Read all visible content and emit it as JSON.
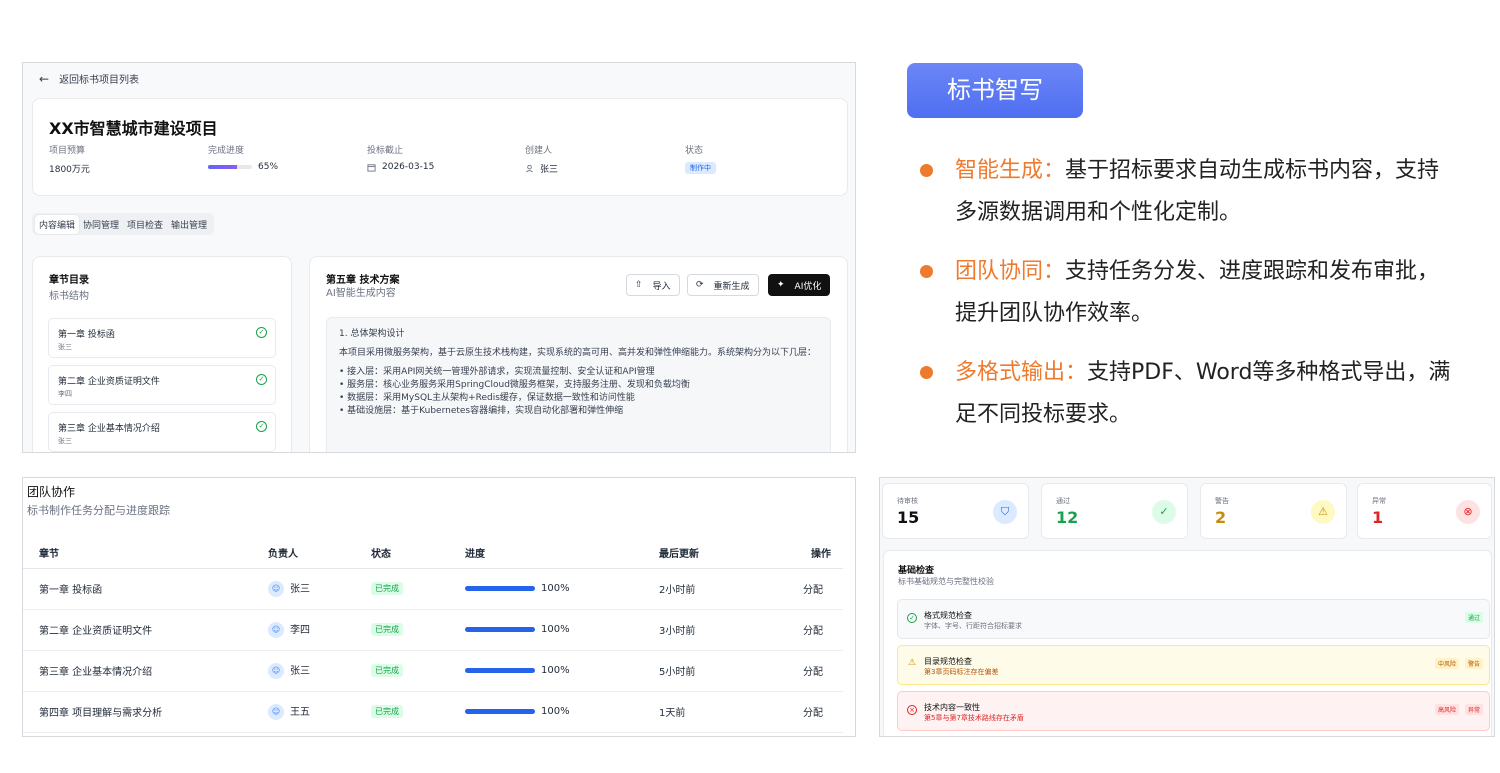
{
  "project": {
    "back_label": "返回标书项目列表",
    "title": "XX市智慧城市建设项目",
    "budget_label": "项目预算",
    "budget_value": "1800万元",
    "progress_label": "完成进度",
    "progress_value": "65%",
    "progress_fraction": 0.65,
    "deadline_label": "投标截止",
    "deadline_value": "2026-03-15",
    "creator_label": "创建人",
    "creator_value": "张三",
    "status_label": "状态",
    "status_value": "制作中",
    "tabs": [
      "内容编辑",
      "协同管理",
      "项目检查",
      "输出管理"
    ]
  },
  "toc": {
    "title": "章节目录",
    "subtitle": "标书结构",
    "items": [
      {
        "title": "第一章 投标函",
        "owner": "张三"
      },
      {
        "title": "第二章 企业资质证明文件",
        "owner": "李四"
      },
      {
        "title": "第三章 企业基本情况介绍",
        "owner": "张三"
      }
    ]
  },
  "editor": {
    "chapter_title": "第五章 技术方案",
    "chapter_subtitle": "AI智能生成内容",
    "import_label": "导入",
    "regen_label": "重新生成",
    "ai_label": "AI优化",
    "heading": "1. 总体架构设计",
    "intro": "本项目采用微服务架构，基于云原生技术栈构建，实现系统的高可用、高并发和弹性伸缩能力。系统架构分为以下几层：",
    "bullets": [
      "• 接入层：采用API网关统一管理外部请求，实现流量控制、安全认证和API管理",
      "• 服务层：核心业务服务采用SpringCloud微服务框架，支持服务注册、发现和负载均衡",
      "• 数据层：采用MySQL主从架构+Redis缓存，保证数据一致性和访问性能",
      "• 基础设施层：基于Kubernetes容器编排，实现自动化部署和弹性伸缩"
    ]
  },
  "features": {
    "badge": "标书智写",
    "items": [
      {
        "highlight": "智能生成：",
        "text": "基于招标要求自动生成标书内容，支持多源数据调用和个性化定制。"
      },
      {
        "highlight": "团队协同：",
        "text": "支持任务分发、进度跟踪和发布审批，提升团队协作效率。"
      },
      {
        "highlight": "多格式输出：",
        "text": "支持PDF、Word等多种格式导出，满足不同投标要求。"
      }
    ]
  },
  "team": {
    "title": "团队协作",
    "subtitle": "标书制作任务分配与进度跟踪",
    "columns": [
      "章节",
      "负责人",
      "状态",
      "进度",
      "最后更新",
      "操作"
    ],
    "rows": [
      {
        "chapter": "第一章 投标函",
        "owner": "张三",
        "status": "已完成",
        "progress": "100%",
        "progress_fraction": 1.0,
        "updated": "2小时前",
        "action": "分配"
      },
      {
        "chapter": "第二章 企业资质证明文件",
        "owner": "李四",
        "status": "已完成",
        "progress": "100%",
        "progress_fraction": 1.0,
        "updated": "3小时前",
        "action": "分配"
      },
      {
        "chapter": "第三章 企业基本情况介绍",
        "owner": "张三",
        "status": "已完成",
        "progress": "100%",
        "progress_fraction": 1.0,
        "updated": "5小时前",
        "action": "分配"
      },
      {
        "chapter": "第四章 项目理解与需求分析",
        "owner": "王五",
        "status": "已完成",
        "progress": "100%",
        "progress_fraction": 1.0,
        "updated": "1天前",
        "action": "分配"
      }
    ]
  },
  "inspection": {
    "stats": [
      {
        "label": "待审核",
        "value": "15",
        "color": "#111111",
        "icon": "shield-icon"
      },
      {
        "label": "通过",
        "value": "12",
        "color": "#16a34a",
        "icon": "check-circle-icon"
      },
      {
        "label": "警告",
        "value": "2",
        "color": "#ca8a04",
        "icon": "warning-icon"
      },
      {
        "label": "异常",
        "value": "1",
        "color": "#dc2626",
        "icon": "error-circle-icon"
      }
    ],
    "basic_title": "基础检查",
    "basic_subtitle": "标书基础规范与完整性校验",
    "checks": [
      {
        "name": "格式规范检查",
        "desc": "字体、字号、行距符合招标要求",
        "tags": [
          "通过"
        ],
        "kind": "pass"
      },
      {
        "name": "目录规范检查",
        "desc": "第3章页码标注存在偏差",
        "tags": [
          "中风险",
          "警告"
        ],
        "kind": "warn"
      },
      {
        "name": "技术内容一致性",
        "desc": "第5章与第7章技术路线存在矛盾",
        "tags": [
          "高风险",
          "异常"
        ],
        "kind": "error"
      }
    ]
  }
}
